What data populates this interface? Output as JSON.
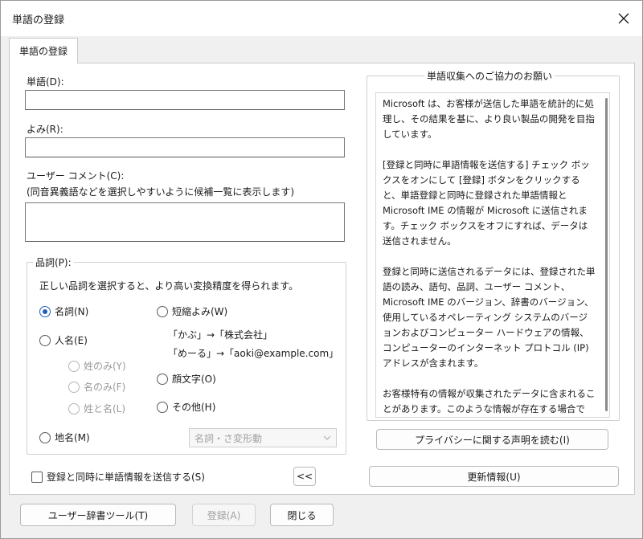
{
  "window": {
    "title": "単語の登録"
  },
  "tab": {
    "label": "単語の登録"
  },
  "form": {
    "word_label": "単語(D):",
    "word_value": "",
    "reading_label": "よみ(R):",
    "reading_value": "",
    "comment_label": "ユーザー コメント(C):",
    "comment_hint": "(同音異義語などを選択しやすいように候補一覧に表示します)",
    "comment_value": ""
  },
  "pos": {
    "group_title": "品詞(P):",
    "description": "正しい品詞を選択すると、より高い変換精度を得られます。",
    "noun": "名詞(N)",
    "person": "人名(E)",
    "surname_only": "姓のみ(Y)",
    "given_only": "名のみ(F)",
    "full_name": "姓と名(L)",
    "place": "地名(M)",
    "short_reading": "短縮よみ(W)",
    "example1": "「かぶ」→「株式会社」",
    "example2": "「めーる」→「aoki@example.com」",
    "emoticon": "顔文字(O)",
    "other": "その他(H)",
    "subtype_selected": "名詞・さ変形動"
  },
  "send_checkbox_label": "登録と同時に単語情報を送信する(S)",
  "collapse_button": "<<",
  "info": {
    "group_title": "単語収集へのご協力のお願い",
    "text": "Microsoft は、お客様が送信した単語を統計的に処理し、その結果を基に、より良い製品の開発を目指しています。\n\n[登録と同時に単語情報を送信する] チェック ボックスをオンにして [登録] ボタンをクリックすると、単語登録と同時に登録された単語情報と Microsoft IME の情報が Microsoft に送信されます。チェック ボックスをオフにすれば、データは送信されません。\n\n登録と同時に送信されるデータには、登録された単語の読み、語句、品詞、ユーザー コメント、Microsoft IME のバージョン、辞書のバージョン、使用しているオペレーティング システムのバージョンおよびコンピューター ハードウェアの情報、コンピューターのインターネット プロトコル (IP) アドレスが含まれます。\n\nお客様特有の情報が収集されたデータに含まれることがあります。このような情報が存在する場合でも、Microsoft では、お客様を特定するために使用することはありません。",
    "privacy_button": "プライバシーに関する声明を読む(I)",
    "update_button": "更新情報(U)"
  },
  "footer": {
    "dictionary_tool": "ユーザー辞書ツール(T)",
    "register": "登録(A)",
    "close": "閉じる"
  },
  "colors": {
    "accent": "#1f5fbf"
  }
}
